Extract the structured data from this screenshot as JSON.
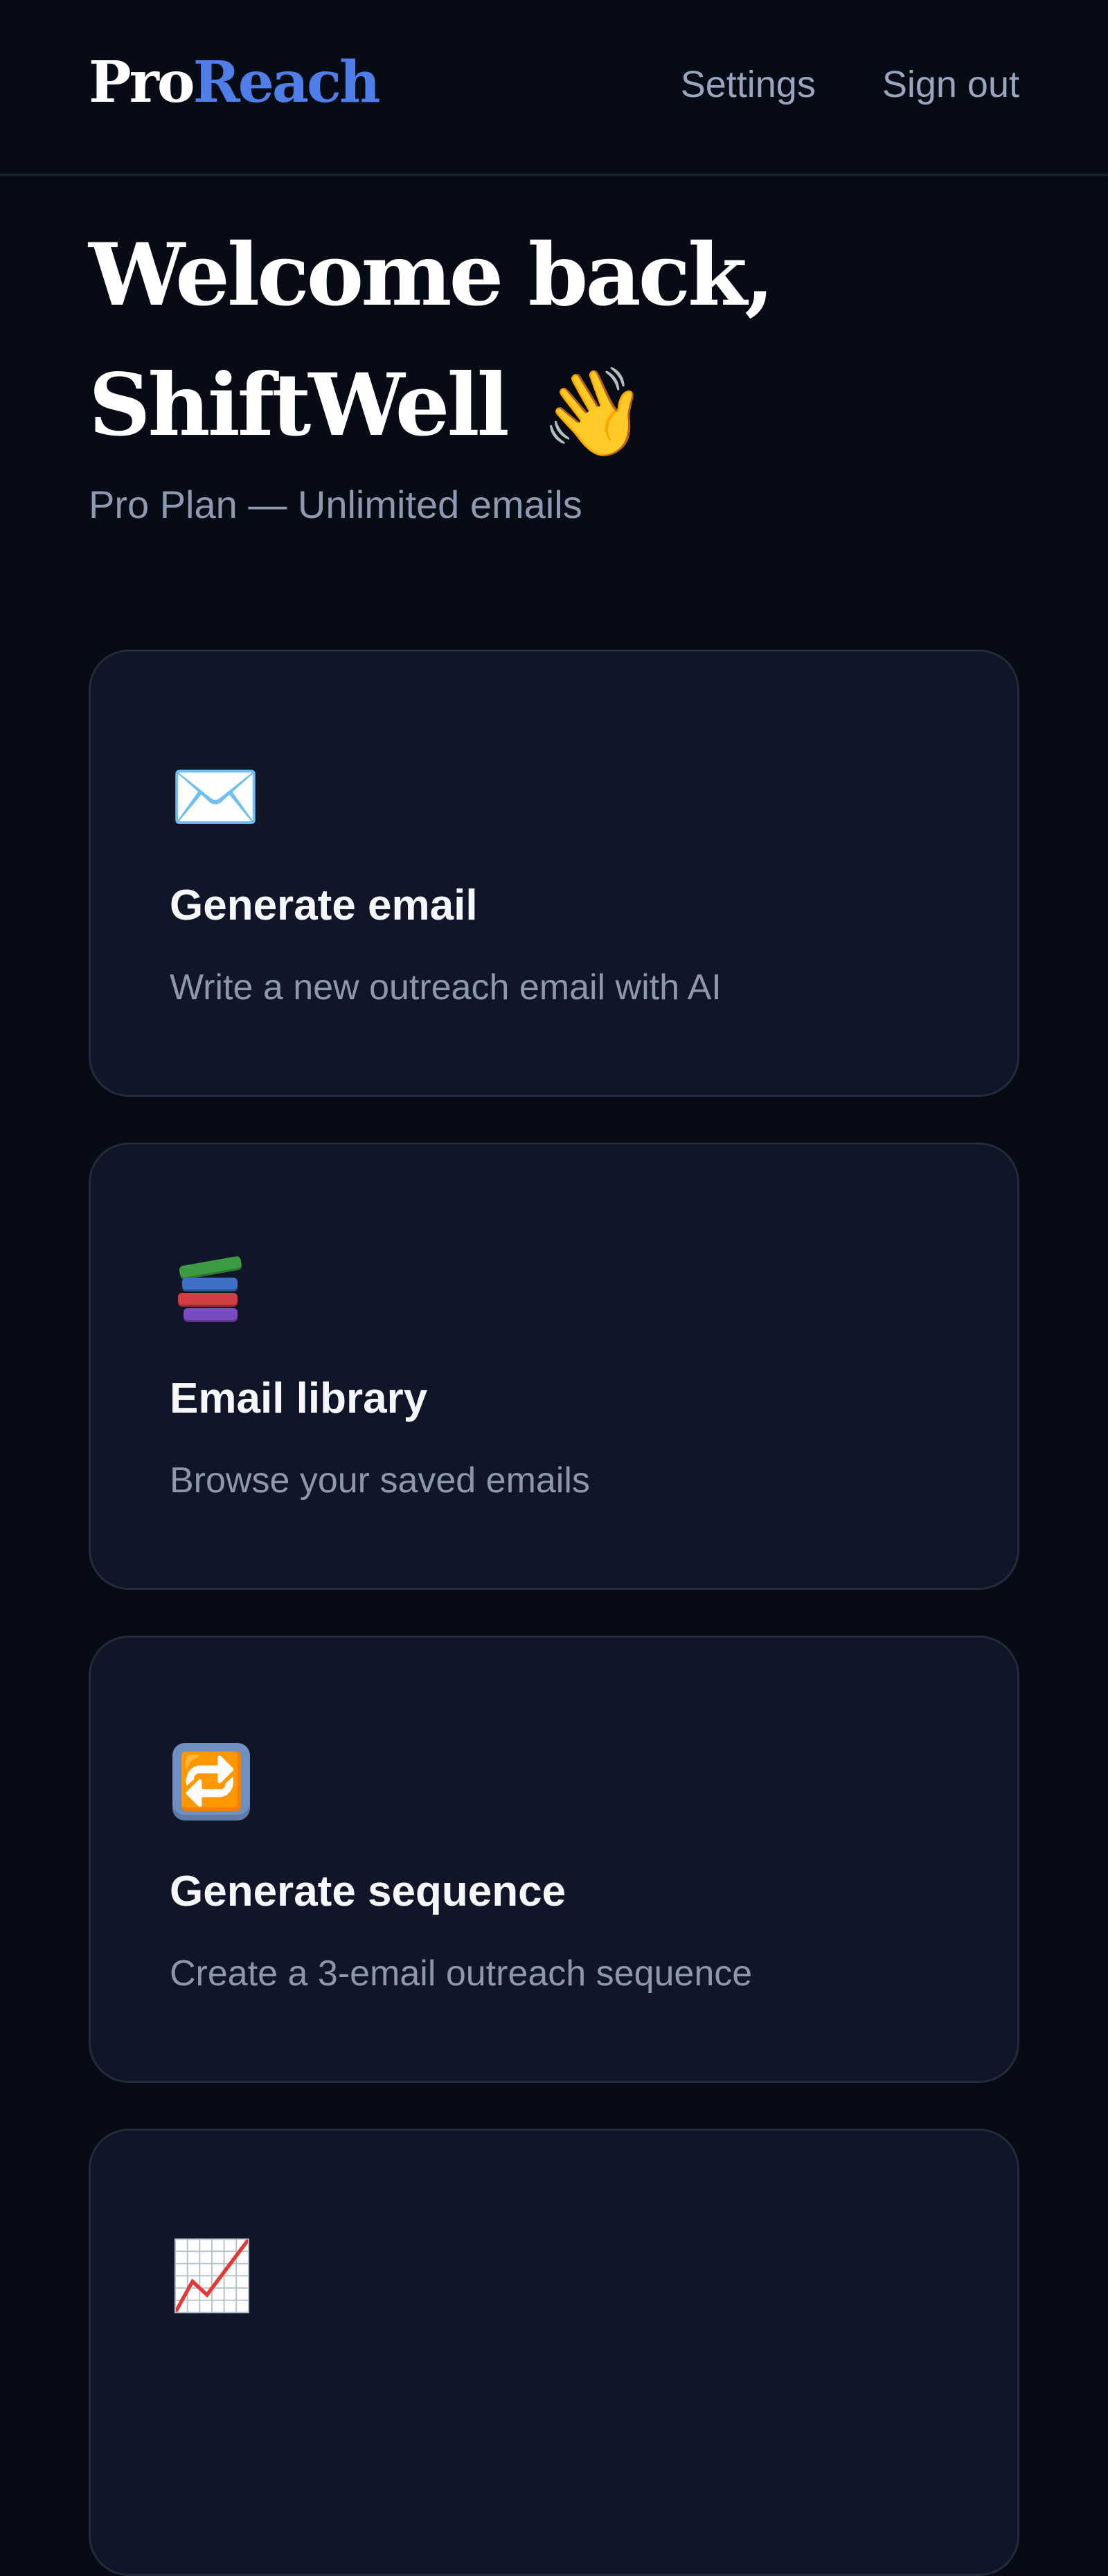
{
  "header": {
    "brand": {
      "part1": "Pro",
      "part2": "Reach"
    },
    "nav": [
      {
        "label": "Settings"
      },
      {
        "label": "Sign out"
      }
    ]
  },
  "hero": {
    "line1": "Welcome back,",
    "line2": "ShiftWell",
    "wave_icon": "👋",
    "plan": "Pro Plan — Unlimited emails"
  },
  "cards": [
    {
      "icon": "✉️",
      "icon_name": "mail-icon",
      "title": "Generate email",
      "description": "Write a new outreach email with AI"
    },
    {
      "icon": "",
      "icon_name": "books-icon",
      "title": "Email library",
      "description": "Browse your saved emails"
    },
    {
      "icon": "🔁",
      "icon_name": "repeat-icon",
      "title": "Generate sequence",
      "description": "Create a 3-email outreach sequence"
    },
    {
      "icon": "📈",
      "icon_name": "chart-icon",
      "title": "",
      "description": ""
    }
  ],
  "colors": {
    "background": "#060b16",
    "card_background": "#101628",
    "border": "#232b3a",
    "brand_accent": "#4f7ee8",
    "text_primary": "#f3f5fa",
    "text_secondary": "#8d98ad"
  }
}
